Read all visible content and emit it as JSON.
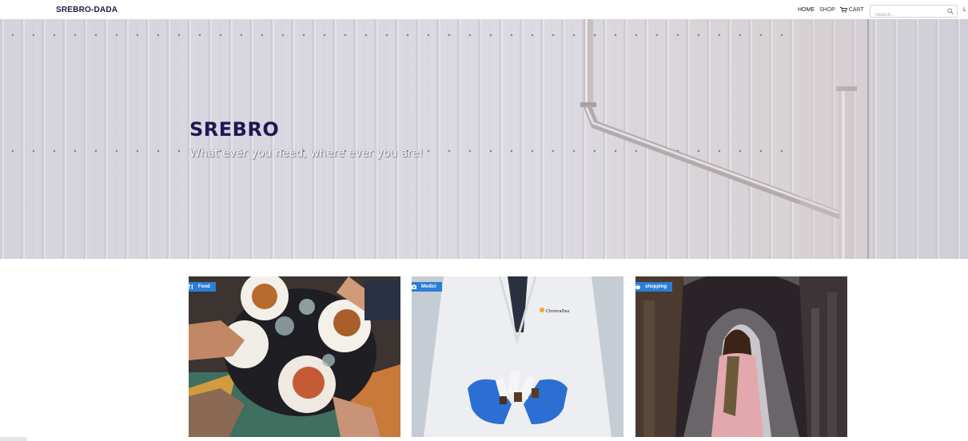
{
  "nav": {
    "brand": "SREBRO-DADA",
    "links": {
      "home": "HOME",
      "shop": "SHOP",
      "cart": "CART"
    },
    "search_placeholder": "Search...",
    "login_partial": "L"
  },
  "hero": {
    "title": "SREBRO",
    "subtitle": "What ever you need, where ever you are!"
  },
  "cards": [
    {
      "tag": "Food",
      "icon": "utensils-icon"
    },
    {
      "tag": "Medici",
      "icon": "medical-kit-icon"
    },
    {
      "tag": "shopping",
      "icon": "shopping-basket-icon"
    }
  ],
  "colors": {
    "brand": "#1d1846",
    "hero_title": "#231653",
    "tag": "#2b7ed6"
  }
}
